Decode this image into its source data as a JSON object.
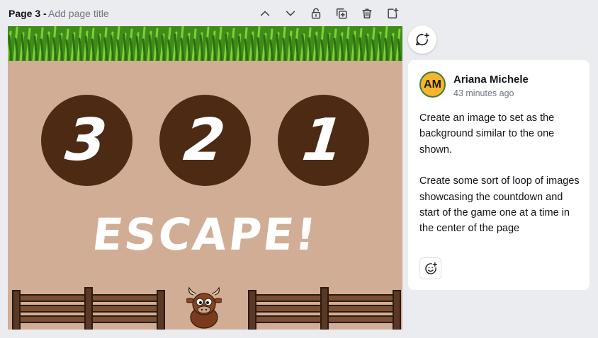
{
  "page_header": {
    "page_label": "Page 3 -",
    "title_placeholder": "Add page title",
    "icons": [
      "chevron-up-icon",
      "chevron-down-icon",
      "lock-icon",
      "duplicate-icon",
      "trash-icon",
      "add-page-icon"
    ]
  },
  "canvas": {
    "countdown": [
      "3",
      "2",
      "1"
    ],
    "headline": "ESCAPE!",
    "colors": {
      "background": "#d2ad95",
      "circle": "#4d2a14",
      "grass": "#4a9a1e"
    }
  },
  "comment_panel": {
    "add_comment_icon": "add-comment-icon",
    "author_initials": "AM",
    "author_name": "Ariana Michele",
    "timestamp": "43 minutes ago",
    "paragraph_1": "Create an image to set as the background similar to the one shown.",
    "paragraph_2": "Create some sort of loop of images showcasing the countdown and start of the game one at a time in the center of the page",
    "reaction_icon": "add-reaction-icon"
  }
}
